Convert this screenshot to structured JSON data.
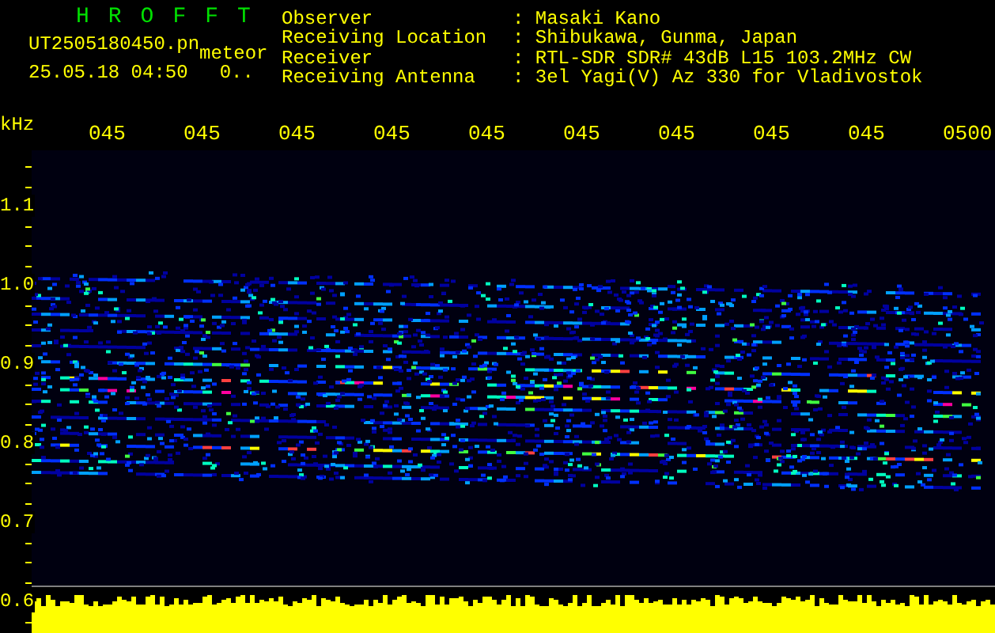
{
  "header": {
    "title": "HROFFT",
    "file_name": "UT2505180450.pn",
    "file_tag": "meteor",
    "timestamp": "25.05.18 04:50",
    "count": "0..",
    "info": [
      {
        "label": "Observer",
        "value": ": Masaki Kano"
      },
      {
        "label": "Receiving Location",
        "value": ": Shibukawa, Gunma, Japan"
      },
      {
        "label": "Receiver",
        "value": ": RTL-SDR SDR# 43dB L15 103.2MHz CW"
      },
      {
        "label": "Receiving Antenna",
        "value": ": 3el Yagi(V) Az 330 for Vladivostok"
      }
    ]
  },
  "spectrogram": {
    "unit": "kHz",
    "time_labels": [
      "045",
      "045",
      "045",
      "045",
      "045",
      "045",
      "045",
      "045",
      "045",
      "0500"
    ],
    "freq_labels": [
      "1.1",
      "1.0",
      "0.9",
      "0.8",
      "0.7",
      "0.6"
    ]
  }
}
